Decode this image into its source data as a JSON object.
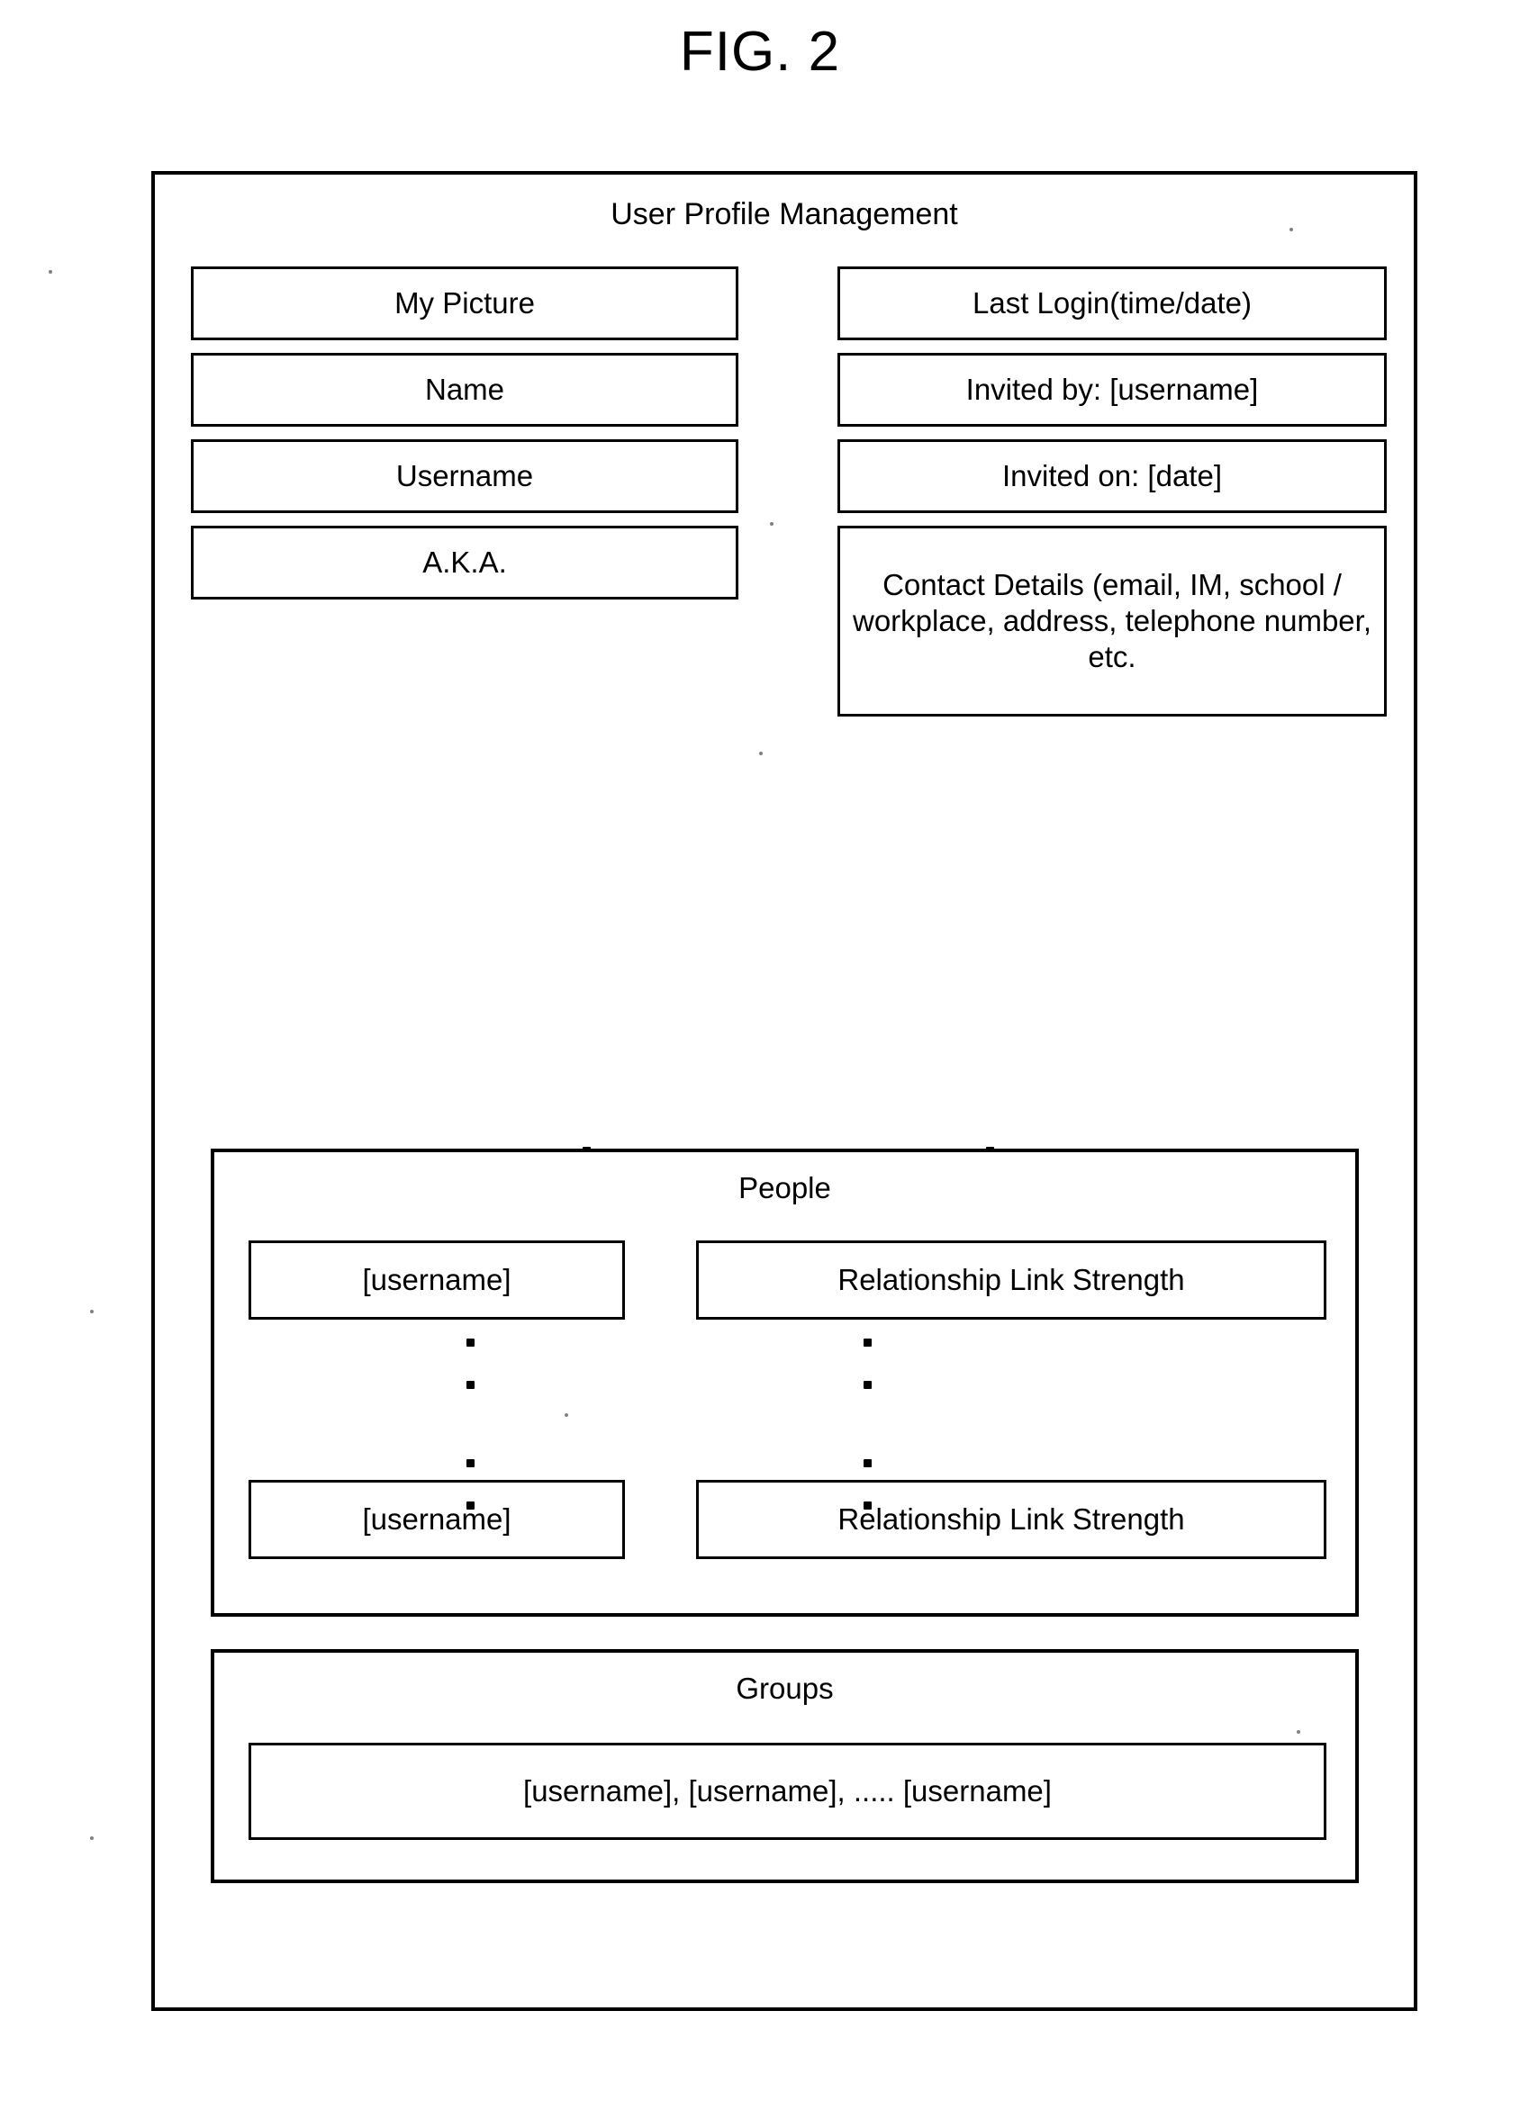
{
  "figure": {
    "label": "FIG. 2"
  },
  "panel": {
    "title": "User Profile Management"
  },
  "fields": {
    "left_column": [
      {
        "label": "My Picture"
      },
      {
        "label": "Name"
      },
      {
        "label": "Username"
      },
      {
        "label": "A.K.A."
      }
    ],
    "right_column": [
      {
        "label": "Last Login(time/date)"
      },
      {
        "label": "Invited by: [username]"
      },
      {
        "label": "Invited on: [date]"
      },
      {
        "label": "Contact Details (email, IM, school / workplace, address, telephone number, etc."
      }
    ]
  },
  "people": {
    "title": "People",
    "rows": [
      {
        "username": "[username]",
        "relationship": "Relationship Link Strength"
      },
      {
        "username": "[username]",
        "relationship": "Relationship Link Strength"
      }
    ]
  },
  "groups": {
    "title": "Groups",
    "members": "[username], [username], .....  [username]"
  }
}
